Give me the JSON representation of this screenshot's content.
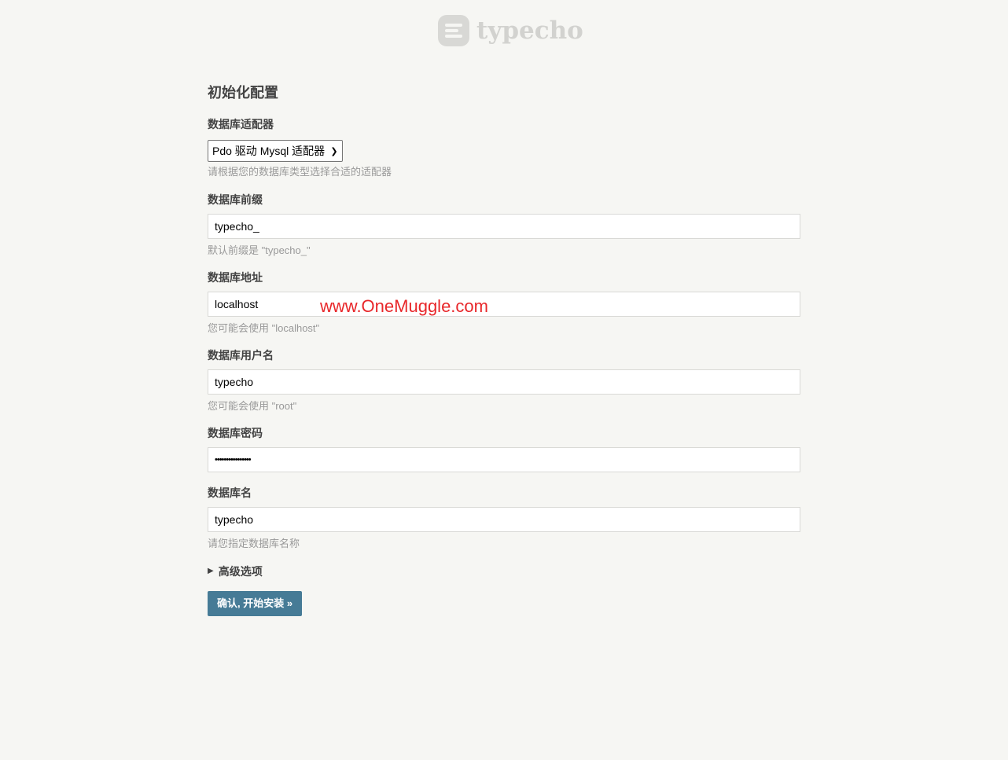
{
  "logo": {
    "text": "typecho",
    "icon": "typecho-logo-icon"
  },
  "page": {
    "title": "初始化配置"
  },
  "form": {
    "adapter": {
      "label": "数据库适配器",
      "selected": "Pdo 驱动 Mysql 适配器",
      "description": "请根据您的数据库类型选择合适的适配器"
    },
    "prefix": {
      "label": "数据库前缀",
      "value": "typecho_",
      "description": "默认前缀是 \"typecho_\""
    },
    "host": {
      "label": "数据库地址",
      "value": "localhost",
      "description": "您可能会使用 \"localhost\""
    },
    "user": {
      "label": "数据库用户名",
      "value": "typecho",
      "description": "您可能会使用 \"root\""
    },
    "password": {
      "label": "数据库密码",
      "value": "••••••••••••••••"
    },
    "dbname": {
      "label": "数据库名",
      "value": "typecho",
      "description": "请您指定数据库名称"
    },
    "advanced": {
      "label": "高级选项"
    },
    "submit_label": "确认, 开始安装 »"
  },
  "watermark": {
    "text": "www.OneMuggle.com"
  },
  "colors": {
    "background": "#f6f6f3",
    "button": "#467b96",
    "watermark": "#e8272a"
  }
}
